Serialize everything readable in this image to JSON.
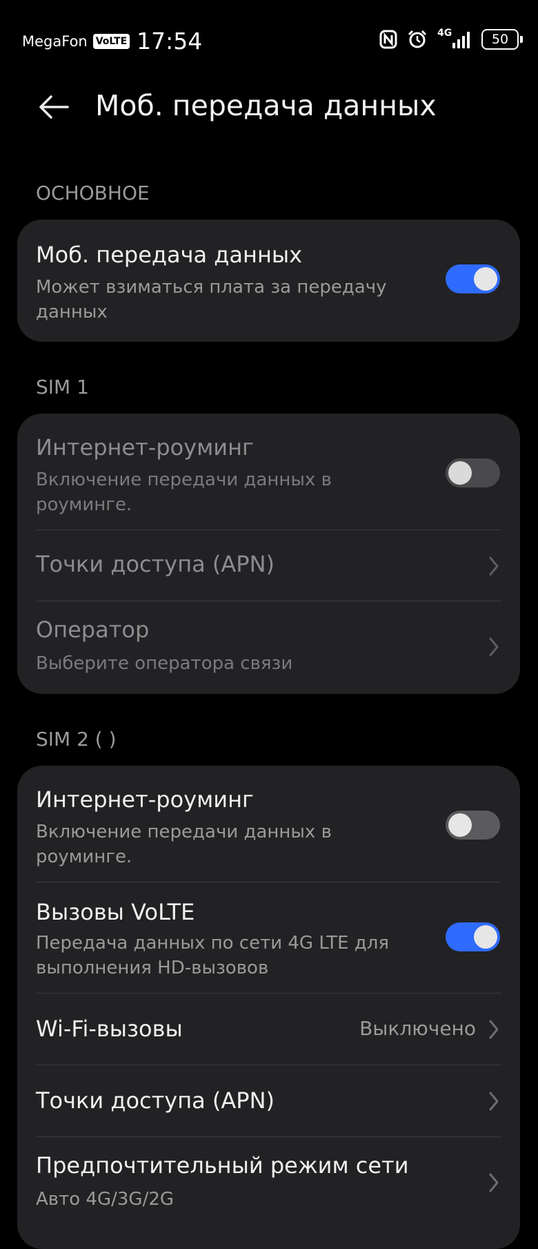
{
  "status_bar": {
    "carrier": "MegaFon",
    "volte_badge": "VoLTE",
    "time": "17:54",
    "network": "4G",
    "battery": "50",
    "icons": [
      "nfc-icon",
      "alarm-icon",
      "signal-icon",
      "battery-icon"
    ]
  },
  "header": {
    "title": "Моб. передача данных",
    "back_icon": "arrow-left-icon"
  },
  "sections": {
    "main": "ОСНОВНОЕ",
    "sim1": "SIM 1",
    "sim2": "SIM 2 (                    )"
  },
  "main_card": {
    "mobile_data": {
      "title": "Моб. передача данных",
      "subtitle": "Может взиматься плата за передачу данных",
      "enabled": true
    }
  },
  "sim1": {
    "roaming": {
      "title": "Интернет-роуминг",
      "subtitle": "Включение передачи данных в роуминге.",
      "enabled": false
    },
    "apn": {
      "title": "Точки доступа (APN)"
    },
    "operator": {
      "title": "Оператор",
      "subtitle": "Выберите оператора связи"
    }
  },
  "sim2": {
    "roaming": {
      "title": "Интернет-роуминг",
      "subtitle": "Включение передачи данных в роуминге.",
      "enabled": false
    },
    "volte": {
      "title": "Вызовы VoLTE",
      "subtitle": "Передача данных по сети 4G LTE для выполнения HD-вызовов",
      "enabled": true
    },
    "wifi_calls": {
      "title": "Wi-Fi-вызовы",
      "value": "Выключено"
    },
    "apn": {
      "title": "Точки доступа (APN)"
    },
    "network_mode": {
      "title": "Предпочтительный режим сети",
      "subtitle": "Авто 4G/3G/2G"
    }
  },
  "colors": {
    "accent": "#2F6BFF",
    "background": "#000000",
    "card": "#222224"
  }
}
